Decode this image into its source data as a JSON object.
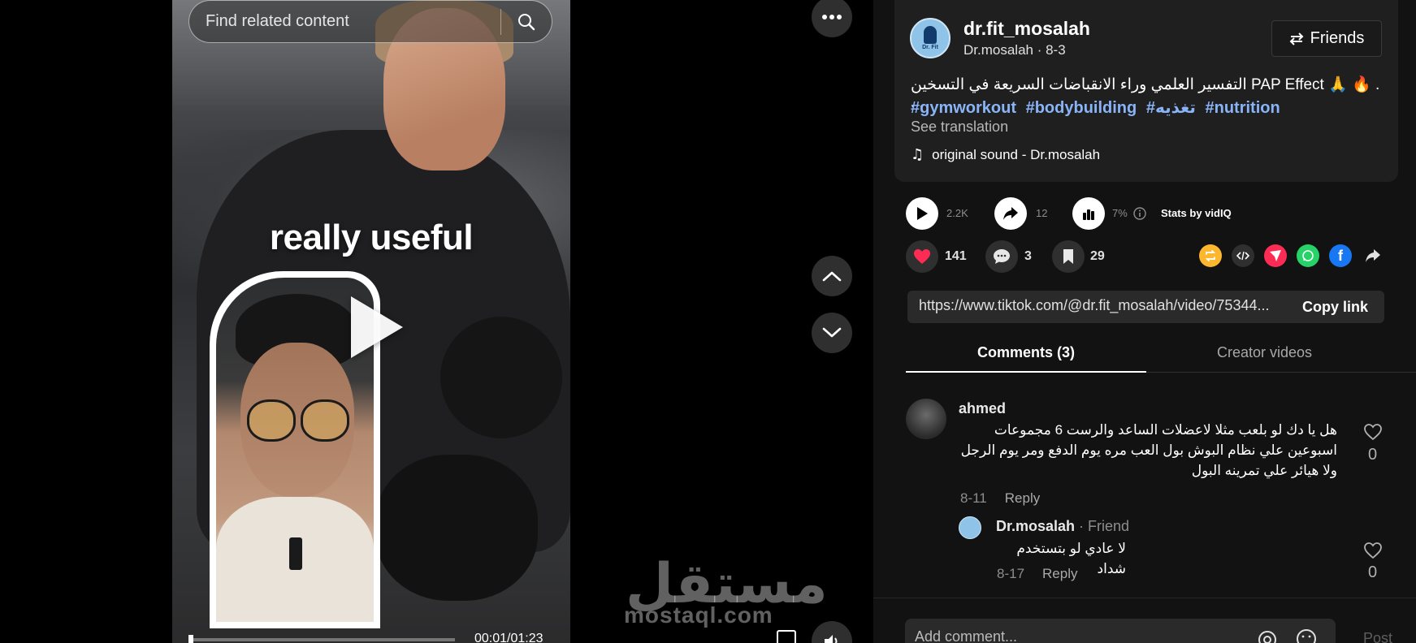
{
  "search": {
    "placeholder": "Find related content"
  },
  "video": {
    "overlay_text": "really useful",
    "time": "00:01/01:23",
    "progress": 0.012,
    "watermark_ar": "مستقل",
    "watermark_en": "mostaql.com"
  },
  "post": {
    "username": "dr.fit_mosalah",
    "display_name": "Dr.mosalah",
    "date": "8-3",
    "subline": "Dr.mosalah · 8-3",
    "friends_label": "Friends",
    "description": "التفسير العلمي وراء الانقباضات السريعة في التسخين PAP Effect 🙏 🔥 . . .",
    "hashtags": [
      "#gymworkout",
      "#bodybuilding",
      "#تغذيه",
      "#nutrition"
    ],
    "see_translation": "See translation",
    "sound": "original sound - Dr.mosalah"
  },
  "stats": {
    "plays": "2.2K",
    "shares": "12",
    "rate": "7%",
    "stats_by": "Stats by vidIQ"
  },
  "actions": {
    "likes": "141",
    "comments": "3",
    "saves": "29"
  },
  "share_colors": {
    "repost": "#fcb72e",
    "embed": "#2f2f2f",
    "send": "#fe2c55",
    "whatsapp": "#25d366",
    "facebook": "#1877f2"
  },
  "link": {
    "url": "https://www.tiktok.com/@dr.fit_mosalah/video/75344...",
    "copy_label": "Copy link"
  },
  "tabs": {
    "comments": "Comments (3)",
    "creator_videos": "Creator videos"
  },
  "comments": [
    {
      "name": "ahmed",
      "text": "هل يا دك لو بلعب مثلا لاعضلات الساعد والرست 6 مجموعات اسبوعين علي نظام البوش بول العب مره يوم الدفع ومر يوم الرجل ولا هيائر علي تمرينه البول",
      "date": "8-11",
      "reply": "Reply",
      "likes": "0"
    },
    {
      "name": "Dr.mosalah",
      "tag": " · Friend",
      "text": "لا عادي لو بتستخدم شداد",
      "date": "8-17",
      "reply": "Reply",
      "likes": "0"
    }
  ],
  "composer": {
    "placeholder": "Add comment...",
    "post_label": "Post"
  }
}
